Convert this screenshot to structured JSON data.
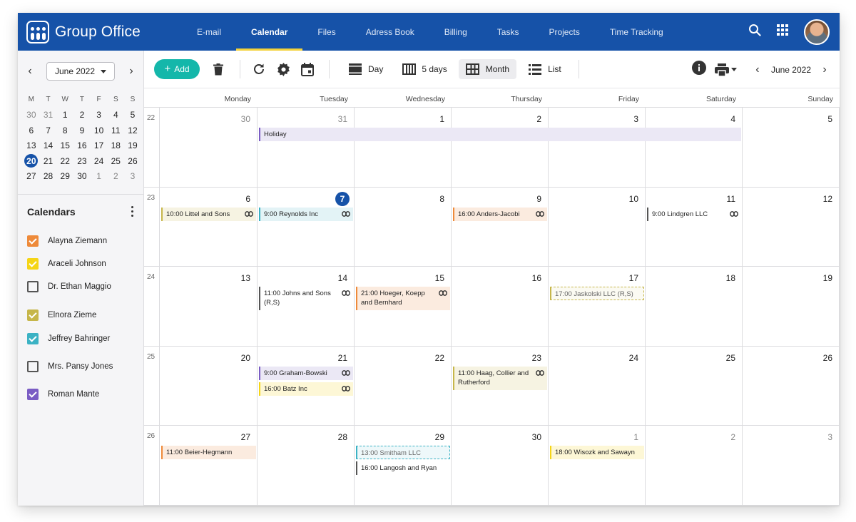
{
  "app": {
    "title": "Group Office",
    "nav": [
      "E-mail",
      "Calendar",
      "Files",
      "Adress Book",
      "Billing",
      "Tasks",
      "Projects",
      "Time Tracking"
    ],
    "active_nav": "Calendar"
  },
  "mini_calendar": {
    "month_label": "June 2022",
    "weekdays": [
      "M",
      "T",
      "W",
      "T",
      "F",
      "S",
      "S"
    ],
    "rows": [
      [
        "30",
        "31",
        "1",
        "2",
        "3",
        "4",
        "5"
      ],
      [
        "6",
        "7",
        "8",
        "9",
        "10",
        "11",
        "12"
      ],
      [
        "13",
        "14",
        "15",
        "16",
        "17",
        "18",
        "19"
      ],
      [
        "20",
        "21",
        "22",
        "23",
        "24",
        "25",
        "26"
      ],
      [
        "27",
        "28",
        "29",
        "30",
        "1",
        "2",
        "3"
      ]
    ],
    "today": "20"
  },
  "calendars": {
    "title": "Calendars",
    "items": [
      {
        "label": "Alayna Ziemann",
        "checked": true,
        "color": "#ee8a3a"
      },
      {
        "label": "Araceli Johnson",
        "checked": true,
        "color": "#f5d516"
      },
      {
        "label": "Dr. Ethan Maggio",
        "checked": false,
        "color": "#555555"
      },
      {
        "label": "Elnora Zieme",
        "checked": true,
        "color": "#c6b64a"
      },
      {
        "label": "Jeffrey Bahringer",
        "checked": true,
        "color": "#3bb2c4"
      },
      {
        "label": "Mrs. Pansy Jones",
        "checked": false,
        "color": "#555555"
      },
      {
        "label": "Roman Mante",
        "checked": true,
        "color": "#7a5cc4"
      }
    ]
  },
  "toolbar": {
    "add_label": "Add",
    "views": [
      "Day",
      "5 days",
      "Month",
      "List"
    ],
    "active_view": "Month",
    "period_label": "June 2022"
  },
  "month": {
    "weekdays": [
      "Monday",
      "Tuesday",
      "Wednesday",
      "Thursday",
      "Friday",
      "Saturday",
      "Sunday"
    ],
    "weeks": [
      {
        "num": "22",
        "days": [
          "30",
          "31",
          "1",
          "2",
          "3",
          "4",
          "5"
        ]
      },
      {
        "num": "23",
        "days": [
          "6",
          "7",
          "8",
          "9",
          "10",
          "11",
          "12"
        ]
      },
      {
        "num": "24",
        "days": [
          "13",
          "14",
          "15",
          "16",
          "17",
          "18",
          "19"
        ]
      },
      {
        "num": "25",
        "days": [
          "20",
          "21",
          "22",
          "23",
          "24",
          "25",
          "26"
        ]
      },
      {
        "num": "26",
        "days": [
          "27",
          "28",
          "29",
          "30",
          "1",
          "2",
          "3"
        ]
      }
    ],
    "today": "7",
    "events": [
      {
        "week": 0,
        "day": 1,
        "span": 5,
        "text": "Holiday",
        "color": "#7a5cc4",
        "bg": "#ebe8f5",
        "link": false,
        "slot": 0
      },
      {
        "week": 1,
        "day": 0,
        "text": "10:00 Littel and Sons",
        "color": "#c6b64a",
        "bg": "#f6f3e2",
        "link": true,
        "slot": 0
      },
      {
        "week": 1,
        "day": 1,
        "text": "9:00 Reynolds Inc",
        "color": "#3bb2c4",
        "bg": "#e3f3f6",
        "link": true,
        "slot": 0
      },
      {
        "week": 1,
        "day": 3,
        "text": "16:00 Anders-Jacobi",
        "color": "#ee8a3a",
        "bg": "#fbebdf",
        "link": true,
        "slot": 0
      },
      {
        "week": 1,
        "day": 5,
        "text": "9:00 Lindgren LLC",
        "color": "#555555",
        "bg": "#ffffff",
        "link": true,
        "slot": 0
      },
      {
        "week": 2,
        "day": 1,
        "text": "11:00 Johns and Sons (R,S)",
        "color": "#555555",
        "bg": "#ffffff",
        "link": true,
        "slot": 0,
        "lines": 2
      },
      {
        "week": 2,
        "day": 2,
        "text": "21:00 Hoeger, Koepp and Bernhard",
        "color": "#ee8a3a",
        "bg": "#fbebdf",
        "link": true,
        "slot": 0,
        "lines": 2
      },
      {
        "week": 2,
        "day": 4,
        "text": "17:00 Jaskolski LLC (R,S)",
        "color": "#c6b64a",
        "bg": "#fbfaf2",
        "link": false,
        "slot": 0,
        "faded": true
      },
      {
        "week": 3,
        "day": 1,
        "text": "9:00 Graham-Bowski",
        "color": "#7a5cc4",
        "bg": "#ebe8f5",
        "link": true,
        "slot": 0
      },
      {
        "week": 3,
        "day": 1,
        "text": "16:00 Batz Inc",
        "color": "#f5d516",
        "bg": "#fdf7d6",
        "link": true,
        "slot": 1
      },
      {
        "week": 3,
        "day": 3,
        "text": "11:00 Haag, Collier and Rutherford",
        "color": "#c6b64a",
        "bg": "#f6f3e2",
        "link": true,
        "slot": 0,
        "lines": 2
      },
      {
        "week": 4,
        "day": 0,
        "text": "11:00 Beier-Hegmann",
        "color": "#ee8a3a",
        "bg": "#fbebdf",
        "link": false,
        "slot": 0
      },
      {
        "week": 4,
        "day": 2,
        "text": "13:00 Smitham LLC",
        "color": "#3bb2c4",
        "bg": "#eef8fa",
        "link": false,
        "slot": 0,
        "faded": true
      },
      {
        "week": 4,
        "day": 2,
        "text": "16:00 Langosh and Ryan",
        "color": "#555555",
        "bg": "#ffffff",
        "link": false,
        "slot": 1
      },
      {
        "week": 4,
        "day": 4,
        "text": "18:00 Wisozk and Sawayn",
        "color": "#f5d516",
        "bg": "#fdf7d6",
        "link": false,
        "slot": 0
      }
    ]
  }
}
